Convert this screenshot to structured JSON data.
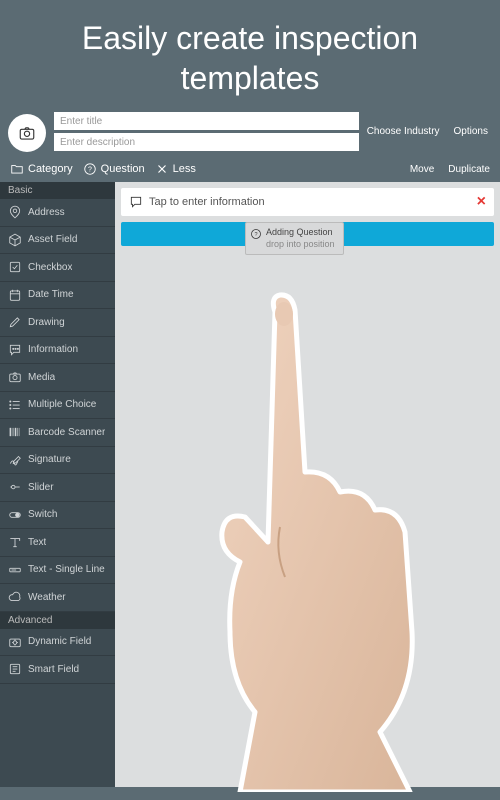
{
  "headline": "Easily create inspection templates",
  "header": {
    "title_placeholder": "Enter title",
    "desc_placeholder": "Enter description",
    "choose_industry": "Choose Industry",
    "options": "Options"
  },
  "toolbar": {
    "category": "Category",
    "question": "Question",
    "less": "Less",
    "move": "Move",
    "duplicate": "Duplicate"
  },
  "sidebar": {
    "basic_label": "Basic",
    "advanced_label": "Advanced",
    "basic": [
      {
        "icon": "pin",
        "label": "Address"
      },
      {
        "icon": "cube",
        "label": "Asset Field"
      },
      {
        "icon": "check",
        "label": "Checkbox"
      },
      {
        "icon": "calendar",
        "label": "Date Time"
      },
      {
        "icon": "pencil",
        "label": "Drawing"
      },
      {
        "icon": "chat",
        "label": "Information"
      },
      {
        "icon": "camera",
        "label": "Media"
      },
      {
        "icon": "list",
        "label": "Multiple Choice"
      },
      {
        "icon": "barcode",
        "label": "Barcode Scanner"
      },
      {
        "icon": "sign",
        "label": "Signature"
      },
      {
        "icon": "slider",
        "label": "Slider"
      },
      {
        "icon": "switch",
        "label": "Switch"
      },
      {
        "icon": "text",
        "label": "Text"
      },
      {
        "icon": "textline",
        "label": "Text - Single Line"
      },
      {
        "icon": "cloud",
        "label": "Weather"
      }
    ],
    "advanced": [
      {
        "icon": "dynamic",
        "label": "Dynamic Field"
      },
      {
        "icon": "smart",
        "label": "Smart Field"
      }
    ]
  },
  "canvas": {
    "tap_hint": "Tap to enter information",
    "drag_title": "Adding Question",
    "drag_sub": "drop into position"
  }
}
